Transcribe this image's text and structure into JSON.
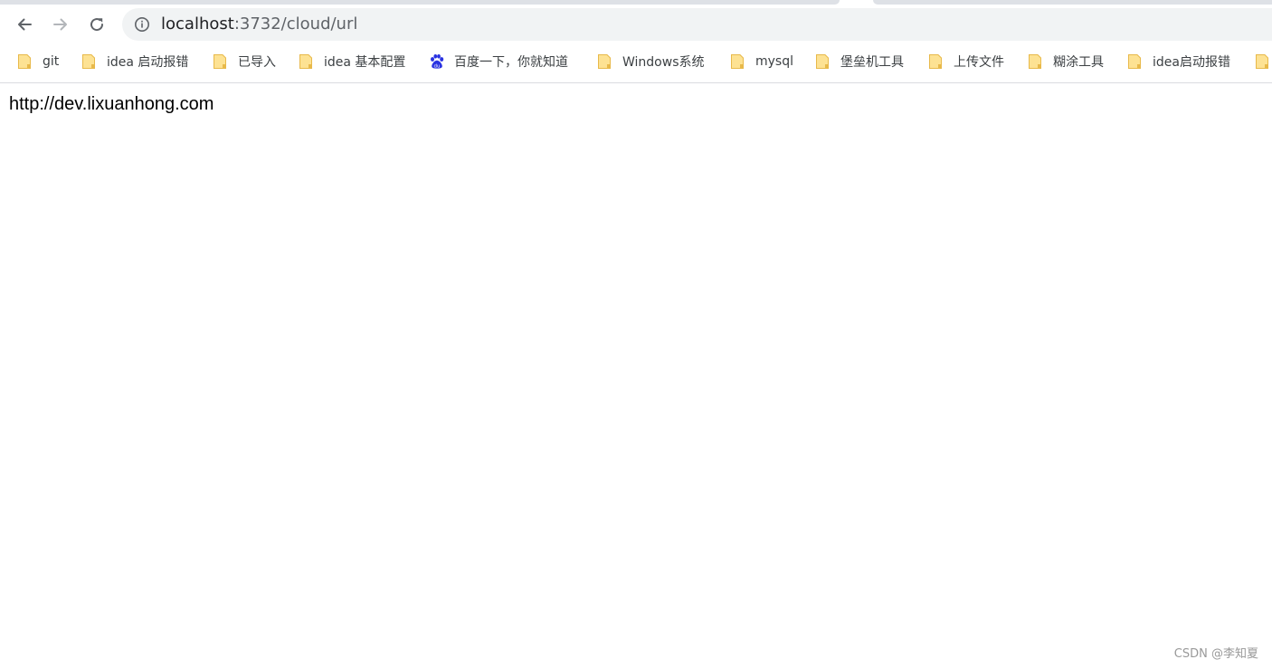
{
  "omnibox": {
    "url_host": "localhost",
    "url_rest": ":3732/cloud/url"
  },
  "bookmarks": [
    {
      "label": "git",
      "icon": "folder-icon"
    },
    {
      "label": "idea 启动报错",
      "icon": "folder-icon"
    },
    {
      "label": "已导入",
      "icon": "folder-icon"
    },
    {
      "label": "idea 基本配置",
      "icon": "folder-icon"
    },
    {
      "label": "百度一下，你就知道",
      "icon": "baidu-paw-icon"
    },
    {
      "label": "Windows系统",
      "icon": "folder-icon"
    },
    {
      "label": "mysql",
      "icon": "folder-icon"
    },
    {
      "label": "堡垒机工具",
      "icon": "folder-icon"
    },
    {
      "label": "上传文件",
      "icon": "folder-icon"
    },
    {
      "label": "糊涂工具",
      "icon": "folder-icon"
    },
    {
      "label": "idea启动报错",
      "icon": "folder-icon"
    }
  ],
  "page": {
    "body_text": "http://dev.lixuanhong.com"
  },
  "watermark": {
    "text": "CSDN @李知夏"
  },
  "colors": {
    "folder_fill": "#fde293",
    "folder_stroke": "#e8b94a",
    "baidu_blue": "#2932e1",
    "omnibox_bg": "#f1f3f4"
  }
}
